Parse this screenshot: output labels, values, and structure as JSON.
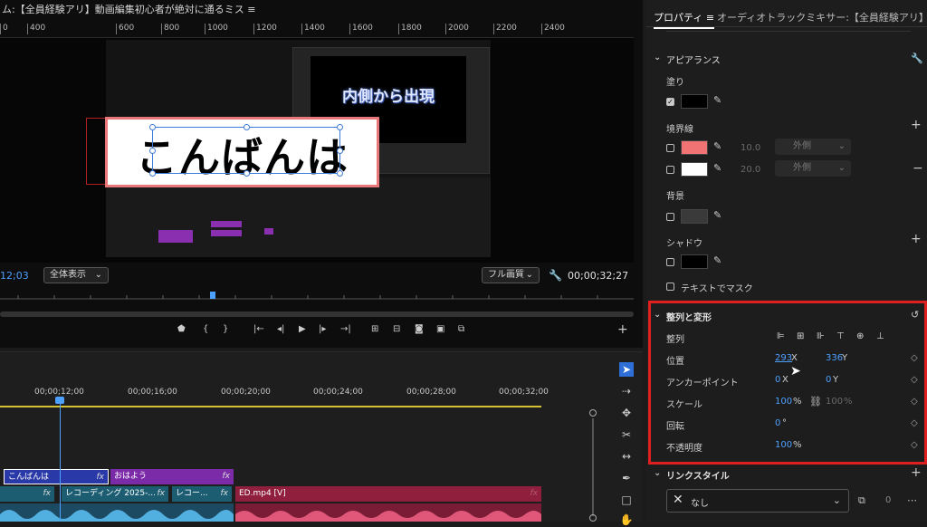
{
  "program_monitor": {
    "title": "ム:【全員経験アリ】動画編集初心者が絶対に通るミス ≡",
    "ruler_ticks": [
      "0",
      "400",
      "600",
      "800",
      "1000",
      "1200",
      "1400",
      "1600",
      "1800",
      "2000",
      "2200",
      "2400"
    ],
    "title_text": "こんばんは",
    "inner_preview_text": "内側から出現",
    "timecode_left": "12;03",
    "zoom_select": "全体表示",
    "quality_select": "フル画質",
    "timecode_right": "00;00;32;27"
  },
  "timeline": {
    "ruler_ticks": [
      "00;00;12;00",
      "00;00;16;00",
      "00;00;20;00",
      "00;00;24;00",
      "00;00;28;00",
      "00;00;32;00"
    ],
    "clips": {
      "v3_clip1": "こんばんは",
      "v3_clip2": "おはよう",
      "v2_clip1": "レコーディング 2025-...",
      "v2_clip2": "レコー...",
      "v2_clip3": "ED.mp4 [V]",
      "fx": "fx"
    }
  },
  "properties": {
    "tab_active": "プロパティ ≡",
    "tab_other": "オーディオトラックミキサー:【全員経験アリ】動画編集",
    "appearance": {
      "heading": "アピアランス",
      "fill_label": "塗り",
      "fill_color": "#000000",
      "stroke_label": "境界線",
      "strokes": [
        {
          "color": "#f27373",
          "width": "10.0",
          "position": "外側"
        },
        {
          "color": "#ffffff",
          "width": "20.0",
          "position": "外側"
        }
      ],
      "background_label": "背景",
      "background_color": "#3a3a3a",
      "shadow_label": "シャドウ",
      "shadow_color": "#000000",
      "mask_label": "テキストでマスク"
    },
    "transform": {
      "heading": "整列と変形",
      "align_label": "整列",
      "position_label": "位置",
      "position_x": "293",
      "position_x_unit": "X",
      "position_y": "336",
      "position_y_unit": "Y",
      "anchor_label": "アンカーポイント",
      "anchor_x": "0",
      "anchor_x_unit": "X",
      "anchor_y": "0",
      "anchor_y_unit": "Y",
      "scale_label": "スケール",
      "scale": "100",
      "scale_unit": "%",
      "scale_linked": "100",
      "scale_linked_unit": "%",
      "rotation_label": "回転",
      "rotation": "0",
      "rotation_unit": "°",
      "opacity_label": "不透明度",
      "opacity": "100",
      "opacity_unit": "%"
    },
    "link_style": {
      "heading": "リンクスタイル",
      "value": "なし",
      "count": "0"
    }
  }
}
